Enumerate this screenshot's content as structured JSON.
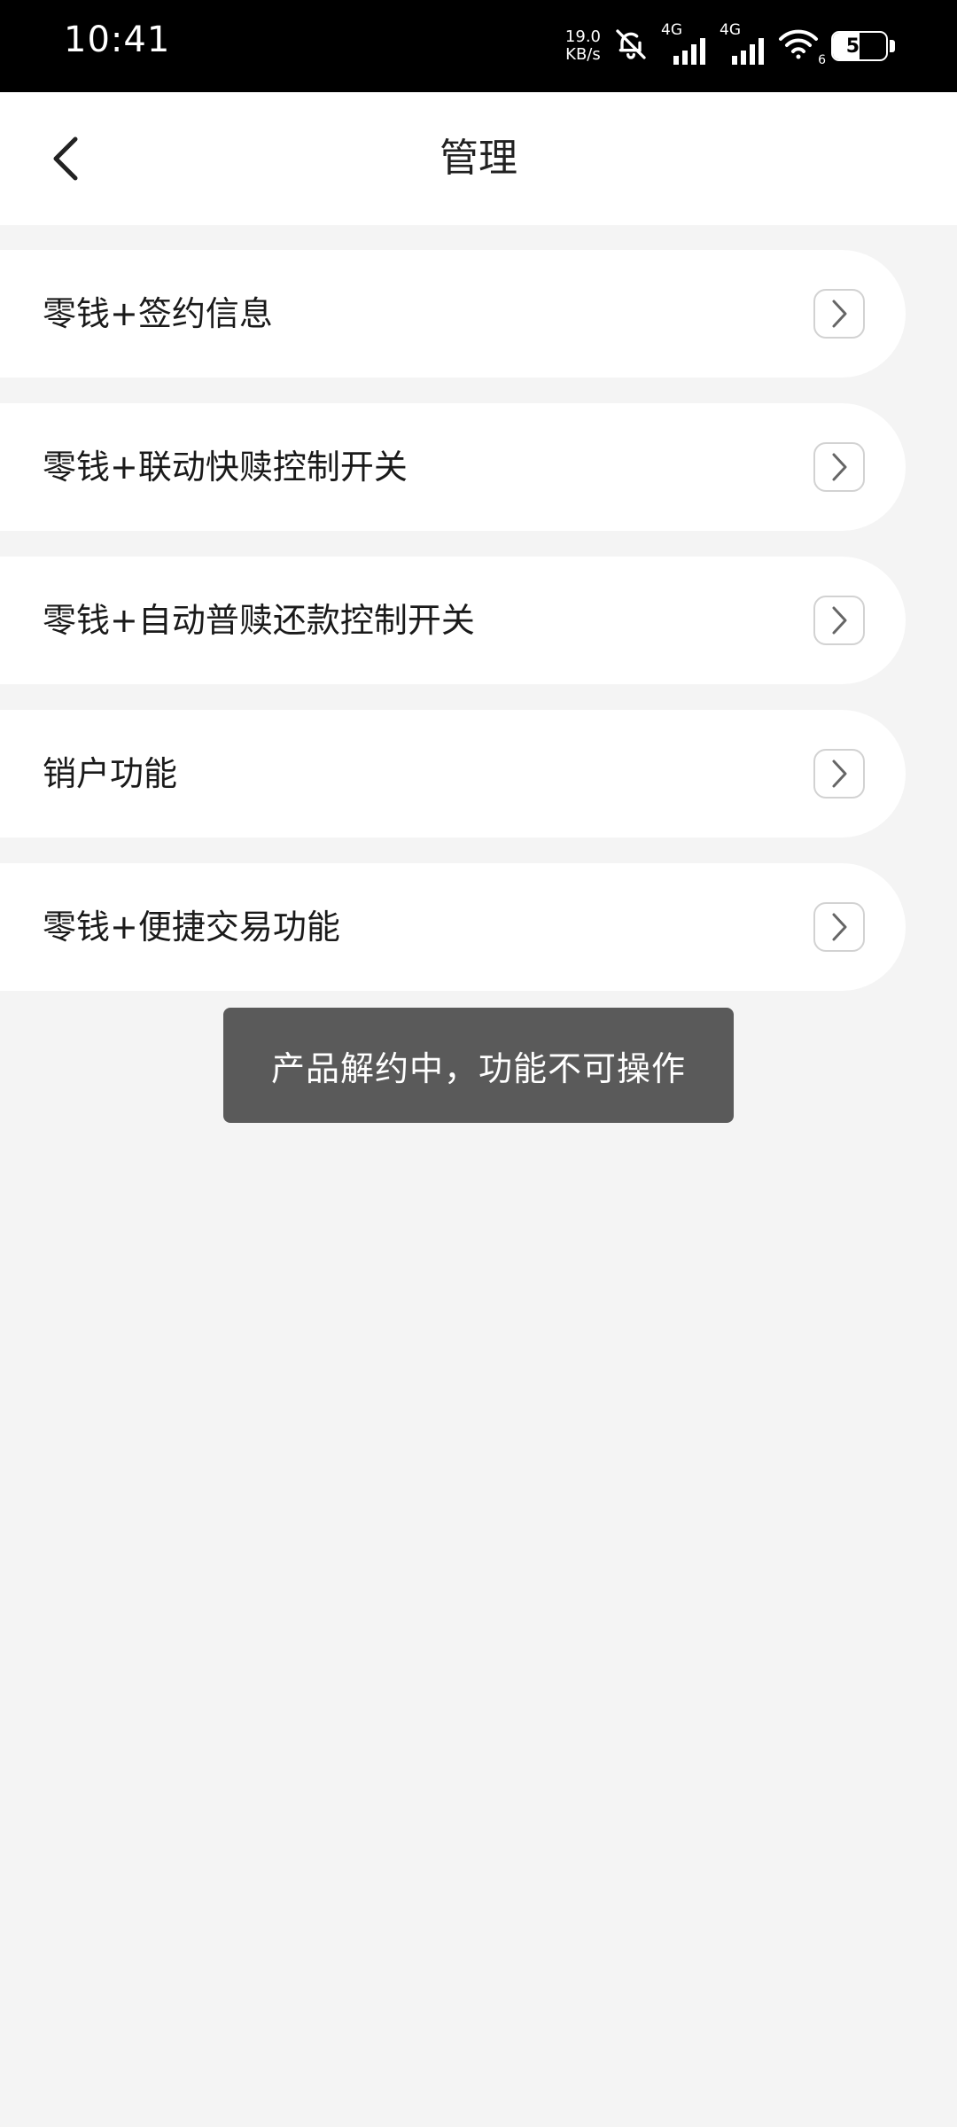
{
  "status_bar": {
    "time": "10:41",
    "net_speed_value": "19.0",
    "net_speed_unit": "KB/s",
    "network_label_1": "4G",
    "network_label_2": "4G",
    "wifi_sub": "6",
    "battery_level": "50",
    "icons": [
      "bell-off-icon",
      "signal-icon",
      "signal-icon",
      "wifi-icon",
      "battery-icon"
    ]
  },
  "header": {
    "title": "管理",
    "back_icon": "chevron-left-icon"
  },
  "menu": {
    "items": [
      {
        "label": "零钱+签约信息"
      },
      {
        "label": "零钱+联动快赎控制开关"
      },
      {
        "label": "零钱+自动普赎还款控制开关"
      },
      {
        "label": "销户功能"
      },
      {
        "label": "零钱+便捷交易功能"
      }
    ],
    "chevron_icon": "chevron-right-icon"
  },
  "toast": {
    "message": "产品解约中，功能不可操作"
  },
  "colors": {
    "background": "#f4f4f4",
    "card": "#ffffff",
    "toast_bg": "#5a5a5a",
    "text": "#1a1a1a"
  }
}
